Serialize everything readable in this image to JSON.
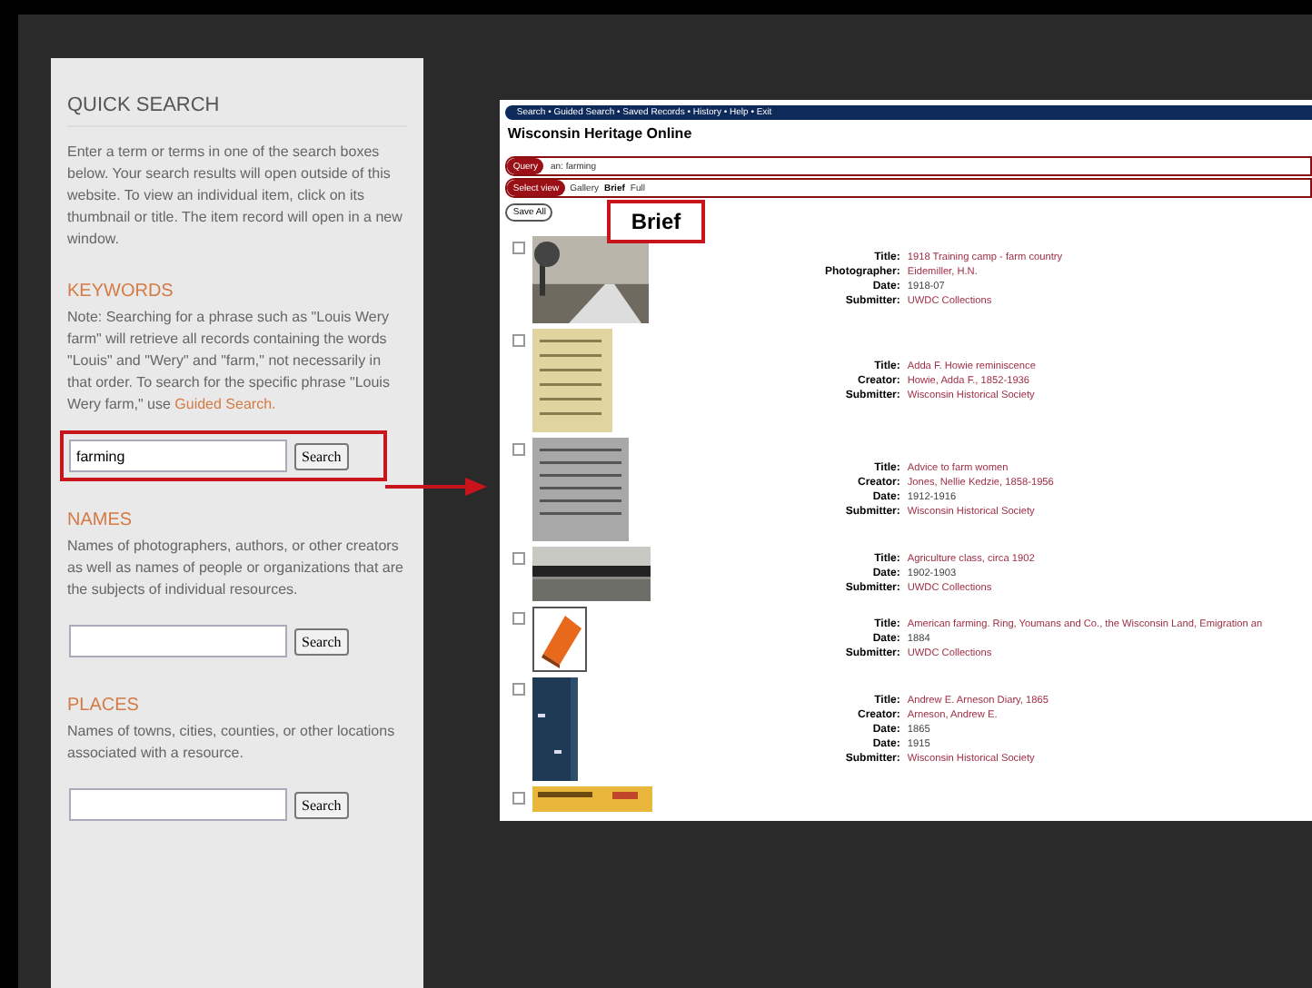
{
  "quick_search": {
    "title": "QUICK SEARCH",
    "intro": "Enter a term or terms in one of the search boxes below. Your search results will open outside of this website. To view an individual item, click on its thumbnail or title. The item record will open in a new window.",
    "sections": [
      {
        "heading": "KEYWORDS",
        "note": "Note: Searching for a phrase such as \"Louis Wery farm\" will retrieve all records containing the words \"Louis\" and \"Wery\" and \"farm,\" not necessarily in that order. To search for the specific phrase \"Louis Wery farm,\" use ",
        "link": "Guided Search.",
        "value": "farming",
        "button": "Search",
        "highlighted": true
      },
      {
        "heading": "NAMES",
        "note": "Names of photographers, authors, or other creators as well as names of people or organizations that are the subjects of individual resources.",
        "button": "Search",
        "highlighted": false
      },
      {
        "heading": "PLACES",
        "note": "Names of towns, cities, counties, or other locations associated with a resource.",
        "button": "Search",
        "highlighted": false
      }
    ]
  },
  "results_page": {
    "nav": [
      "Search",
      "Guided Search",
      "Saved Records",
      "History",
      "Help",
      "Exit"
    ],
    "separator": "•",
    "site_title": "Wisconsin Heritage Online",
    "query_label": "Query",
    "query": "an: farming",
    "view_label": "Select view",
    "views": [
      {
        "label": "Gallery",
        "selected": false
      },
      {
        "label": "Brief",
        "selected": true
      },
      {
        "label": "Full",
        "selected": false
      }
    ],
    "save_all": "Save All",
    "callout": "Brief",
    "rows": [
      {
        "checked": false,
        "kind": "picture",
        "fields": [
          {
            "label": "Title:",
            "value": "1918 Training camp - farm country",
            "kind": "link"
          },
          {
            "label": "Photographer:",
            "value": "Eidemiller, H.N.",
            "kind": "link"
          },
          {
            "label": "Date:",
            "value": "1918-07",
            "kind": "plain"
          },
          {
            "label": "Submitter:",
            "value": "UWDC Collections",
            "kind": "link"
          }
        ]
      },
      {
        "checked": false,
        "kind": "picture",
        "fields": [
          {
            "label": "Title:",
            "value": "Adda F. Howie reminiscence",
            "kind": "link"
          },
          {
            "label": "Creator:",
            "value": "Howie, Adda F., 1852-1936",
            "kind": "link"
          },
          {
            "label": "Submitter:",
            "value": "Wisconsin Historical Society",
            "kind": "link"
          }
        ]
      },
      {
        "checked": false,
        "kind": "picture",
        "fields": [
          {
            "label": "Title:",
            "value": "Advice to farm women",
            "kind": "link"
          },
          {
            "label": "Creator:",
            "value": "Jones, Nellie Kedzie, 1858-1956",
            "kind": "link"
          },
          {
            "label": "Date:",
            "value": "1912-1916",
            "kind": "plain"
          },
          {
            "label": "Submitter:",
            "value": "Wisconsin Historical Society",
            "kind": "link"
          }
        ]
      },
      {
        "checked": false,
        "kind": "picture",
        "fields": [
          {
            "label": "Title:",
            "value": "Agriculture class, circa 1902",
            "kind": "link"
          },
          {
            "label": "Date:",
            "value": "1902-1903",
            "kind": "plain"
          },
          {
            "label": "Submitter:",
            "value": "UWDC Collections",
            "kind": "link"
          }
        ]
      },
      {
        "checked": false,
        "kind": "book",
        "fields": [
          {
            "label": "Title:",
            "value": "American farming. Ring, Youmans and Co., the Wisconsin Land, Emigration an",
            "kind": "link"
          },
          {
            "label": "Date:",
            "value": "1884",
            "kind": "plain"
          },
          {
            "label": "Submitter:",
            "value": "UWDC Collections",
            "kind": "link"
          }
        ]
      },
      {
        "checked": false,
        "kind": "picture",
        "fields": [
          {
            "label": "Title:",
            "value": "Andrew E. Arneson Diary, 1865",
            "kind": "link"
          },
          {
            "label": "Creator:",
            "value": "Arneson, Andrew E.",
            "kind": "link"
          },
          {
            "label": "Date:",
            "value": "1865",
            "kind": "plain"
          },
          {
            "label": "Date:",
            "value": "1915",
            "kind": "plain"
          },
          {
            "label": "Submitter:",
            "value": "Wisconsin Historical Society",
            "kind": "link"
          }
        ]
      },
      {
        "checked": false,
        "kind": "picture",
        "fields": []
      }
    ]
  }
}
